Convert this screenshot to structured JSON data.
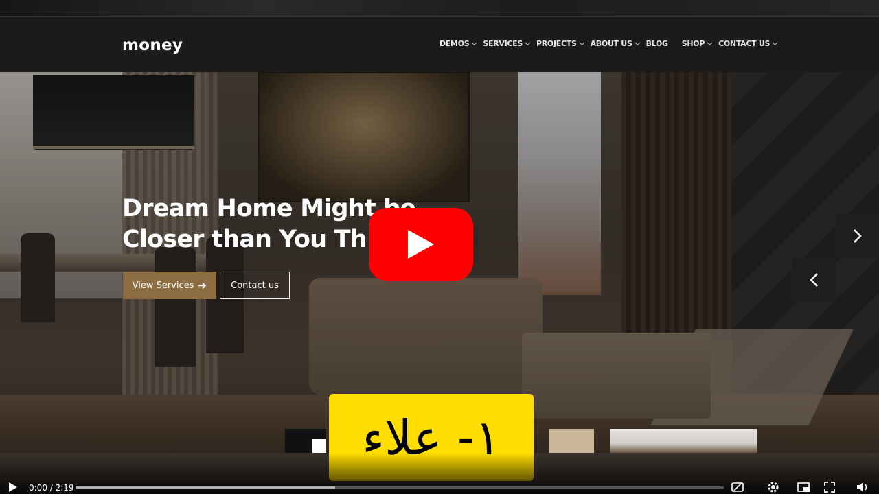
{
  "site": {
    "logo": "money",
    "nav": [
      {
        "label": "DEMOS",
        "dropdown": true
      },
      {
        "label": "SERVICES",
        "dropdown": true
      },
      {
        "label": "PROJECTS",
        "dropdown": true
      },
      {
        "label": "ABOUT US",
        "dropdown": true
      },
      {
        "label": "BLOG",
        "dropdown": false
      },
      {
        "label": "SHOP",
        "dropdown": true
      },
      {
        "label": "CONTACT US",
        "dropdown": true
      }
    ]
  },
  "hero": {
    "title": "Dream Home Might be\nCloser than You Th",
    "primary_button": "View Services",
    "secondary_button": "Contact us"
  },
  "caption": {
    "text": "١- علاء",
    "background": "#ffdd00"
  },
  "player": {
    "current_time": "0:00",
    "duration": "2:19",
    "time_display": "0:00 / 2:19",
    "progress": 0.0,
    "buffered": 0.4,
    "play_color": "#ff0000"
  },
  "icons": {
    "play": "play-icon",
    "next": "chevron-right-icon",
    "prev": "chevron-left-icon",
    "subtitles": "subtitles-off-icon",
    "settings": "gear-icon",
    "miniplayer": "miniplayer-icon",
    "fullscreen": "fullscreen-icon",
    "volume": "volume-icon"
  }
}
